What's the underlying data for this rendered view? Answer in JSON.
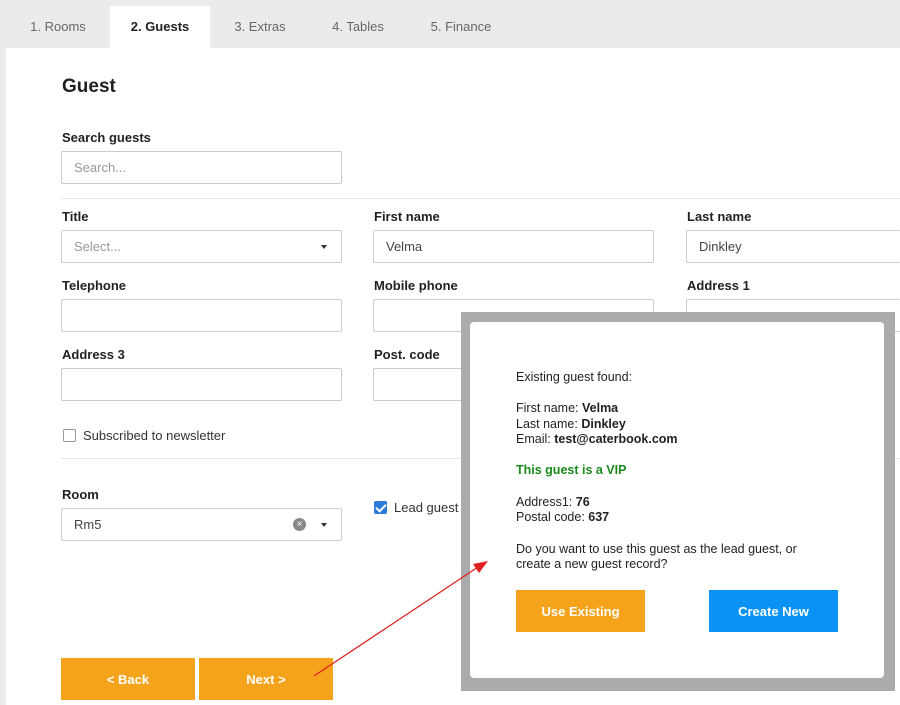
{
  "tabs": [
    {
      "label": "1. Rooms",
      "active": false
    },
    {
      "label": "2. Guests",
      "active": true
    },
    {
      "label": "3. Extras",
      "active": false
    },
    {
      "label": "4. Tables",
      "active": false
    },
    {
      "label": "5. Finance",
      "active": false
    }
  ],
  "form": {
    "heading": "Guest",
    "search": {
      "label": "Search guests",
      "placeholder": "Search..."
    },
    "title": {
      "label": "Title",
      "placeholder": "Select..."
    },
    "first_name": {
      "label": "First name",
      "value": "Velma"
    },
    "last_name": {
      "label": "Last name",
      "value": "Dinkley"
    },
    "telephone": {
      "label": "Telephone",
      "value": ""
    },
    "mobile_phone": {
      "label": "Mobile phone",
      "value": ""
    },
    "address1": {
      "label": "Address 1",
      "value": ""
    },
    "address3": {
      "label": "Address 3",
      "value": ""
    },
    "post_code": {
      "label": "Post. code",
      "value": ""
    },
    "newsletter": {
      "label": "Subscribed to newsletter",
      "checked": false
    },
    "room": {
      "label": "Room",
      "value": "Rm5"
    },
    "lead_guest": {
      "label": "Lead guest",
      "checked": true
    }
  },
  "buttons": {
    "back": "< Back",
    "next": "Next >"
  },
  "modal": {
    "heading": "Existing guest found:",
    "first_name_label": "First name: ",
    "first_name": "Velma",
    "last_name_label": "Last name: ",
    "last_name": "Dinkley",
    "email_label": "Email: ",
    "email": "test@caterbook.com",
    "vip_text": "This guest is a VIP",
    "address1_label": "Address1: ",
    "address1": "76",
    "postal_label": "Postal code: ",
    "postal": "637",
    "question_line1": "Do you want to use this guest as the lead guest, or",
    "question_line2": "create a new guest record?",
    "use_existing": "Use Existing",
    "create_new": "Create New"
  },
  "colors": {
    "orange": "#f5a31a",
    "blue": "#0a93f5",
    "vip_green": "#1b8a1b",
    "arrow_red": "#e02020",
    "checkbox_blue": "#2d7bd8"
  }
}
